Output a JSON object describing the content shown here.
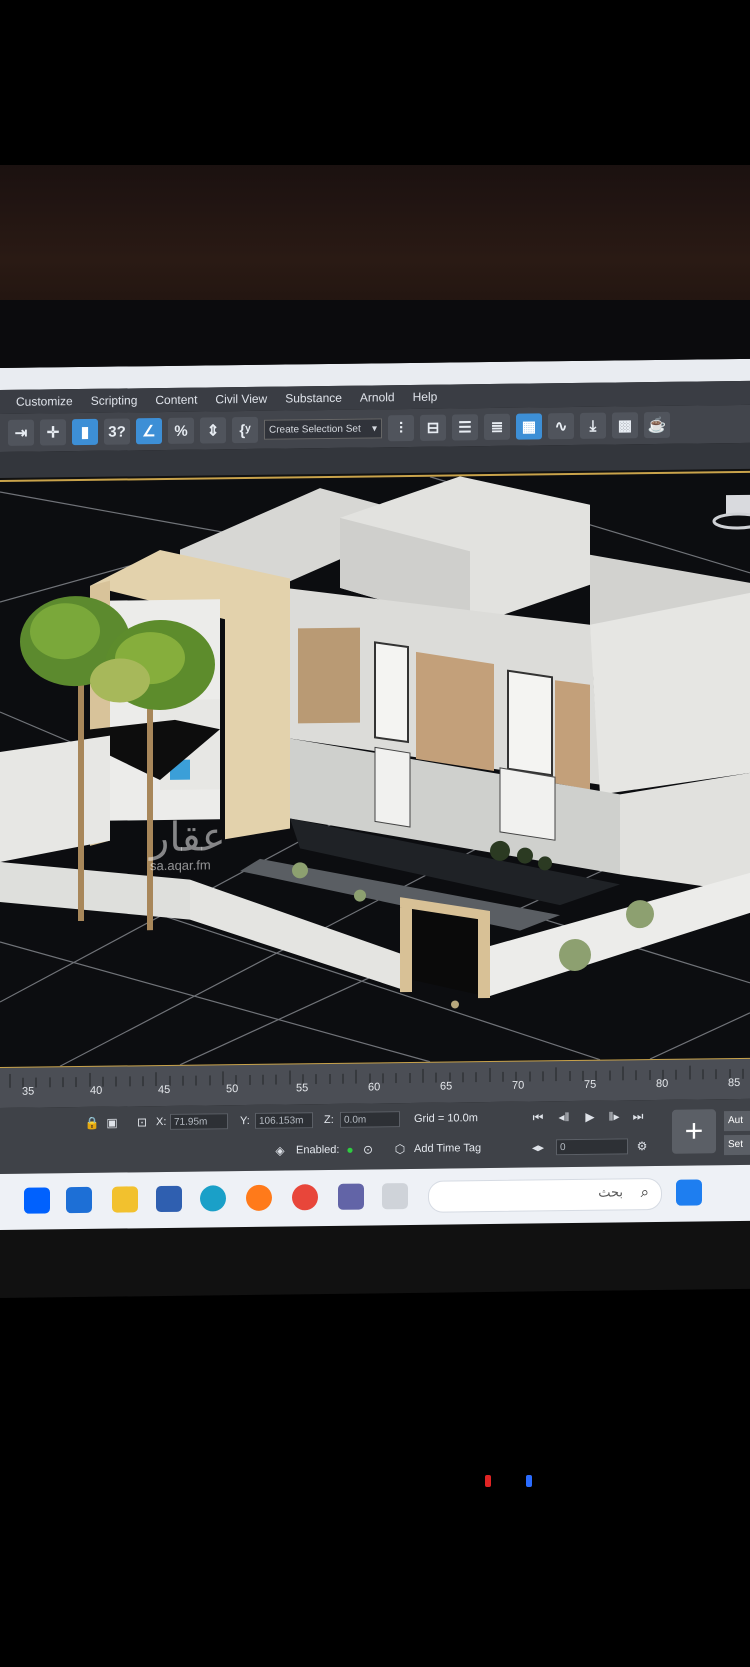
{
  "menu": {
    "items": [
      "Customize",
      "Scripting",
      "Content",
      "Civil View",
      "Substance",
      "Arnold",
      "Help"
    ]
  },
  "toolbar": {
    "selection_set_placeholder": "Create Selection Set",
    "snap_label": "3",
    "percent_label": "%",
    "braces_label": "{"
  },
  "watermark": {
    "logo": "عقار",
    "url": "sa.aqar.fm"
  },
  "timeline": {
    "ticks": [
      "35",
      "40",
      "45",
      "50",
      "55",
      "60",
      "65",
      "70",
      "75",
      "80",
      "85"
    ]
  },
  "status": {
    "x_label": "X:",
    "x_value": "71.95m",
    "y_label": "Y:",
    "y_value": "106.153m",
    "z_label": "Z:",
    "z_value": "0.0m",
    "grid": "Grid = 10.0m",
    "enabled_label": "Enabled:",
    "add_time_tag": "Add Time Tag",
    "frame_value": "0",
    "auto_label": "Aut",
    "set_label": "Set"
  },
  "taskbar": {
    "search_placeholder": "بحث"
  },
  "colors": {
    "accent_blue": "#3d8fd6",
    "viewport_border": "#c9a34b",
    "enabled_dot": "#2ecc40",
    "led_red": "#e02424",
    "led_blue": "#2b6cff"
  },
  "icons": [
    "dropbox-icon",
    "mail-icon",
    "file-explorer-icon",
    "store-icon",
    "edge-icon",
    "firefox-icon",
    "chrome-icon",
    "teams-icon",
    "app-icon",
    "windows-start-icon",
    "search-icon"
  ]
}
